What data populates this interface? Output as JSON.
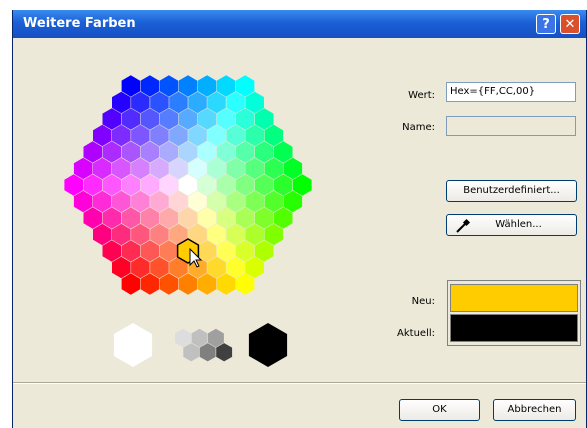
{
  "window": {
    "title": "Weitere Farben",
    "help_glyph": "?",
    "close_glyph": "✕"
  },
  "form": {
    "wert_label": "Wert:",
    "wert_value": "Hex={FF,CC,00}",
    "name_label": "Name:",
    "name_value": ""
  },
  "buttons": {
    "custom_label": "Benutzerdefiniert...",
    "pick_label": "Wählen...",
    "ok_label": "OK",
    "cancel_label": "Abbrechen"
  },
  "preview": {
    "new_label": "Neu:",
    "current_label": "Aktuell:",
    "new_color": "#ffcc00",
    "current_color": "#000000"
  },
  "palette": {
    "selected_color": "#ffcc00",
    "grays": [
      "#ffffff",
      "#dddddd",
      "#c0c0c0",
      "#a0a0a0",
      "#808080",
      "#606060",
      "#404040",
      "#000000"
    ]
  }
}
